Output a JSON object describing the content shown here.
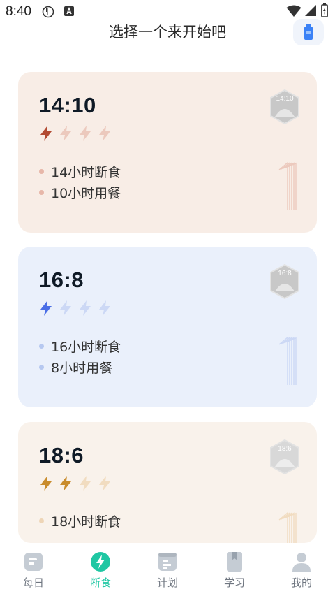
{
  "status_bar": {
    "time": "8:40"
  },
  "header": {
    "title": "选择一个来开始吧"
  },
  "plans": [
    {
      "name": "14:10",
      "badge": "14:10",
      "difficulty": 1,
      "max": 4,
      "fasting": "14小时断食",
      "eating": "10小时用餐",
      "colors": {
        "bg": "#f8ede6",
        "accent": "#b24a32",
        "light": "#ecc9bd",
        "dot": "#e7b7a9",
        "badge": "#c8c8c8"
      }
    },
    {
      "name": "16:8",
      "badge": "16:8",
      "difficulty": 1,
      "max": 4,
      "fasting": "16小时断食",
      "eating": "8小时用餐",
      "colors": {
        "bg": "#eaf0fb",
        "accent": "#4a6ee6",
        "light": "#ccd8f5",
        "dot": "#b6c8f0",
        "badge": "#c8c8c8"
      }
    },
    {
      "name": "18:6",
      "badge": "18:6",
      "difficulty": 2,
      "max": 4,
      "fasting": "18小时断食",
      "eating": "",
      "colors": {
        "bg": "#f9f2eb",
        "accent": "#c98c2c",
        "light": "#f1dcc0",
        "dot": "#eed5b6",
        "badge": "#d8d8d8"
      }
    }
  ],
  "tabs": [
    {
      "label": "每日",
      "icon": "daily-icon",
      "active": false
    },
    {
      "label": "断食",
      "icon": "fasting-icon",
      "active": true
    },
    {
      "label": "计划",
      "icon": "plan-icon",
      "active": false
    },
    {
      "label": "学习",
      "icon": "learn-icon",
      "active": false
    },
    {
      "label": "我的",
      "icon": "profile-icon",
      "active": false
    }
  ],
  "theme": {
    "active_tab": "#1fc7a3",
    "inactive_tab": "#c5ccd4"
  }
}
